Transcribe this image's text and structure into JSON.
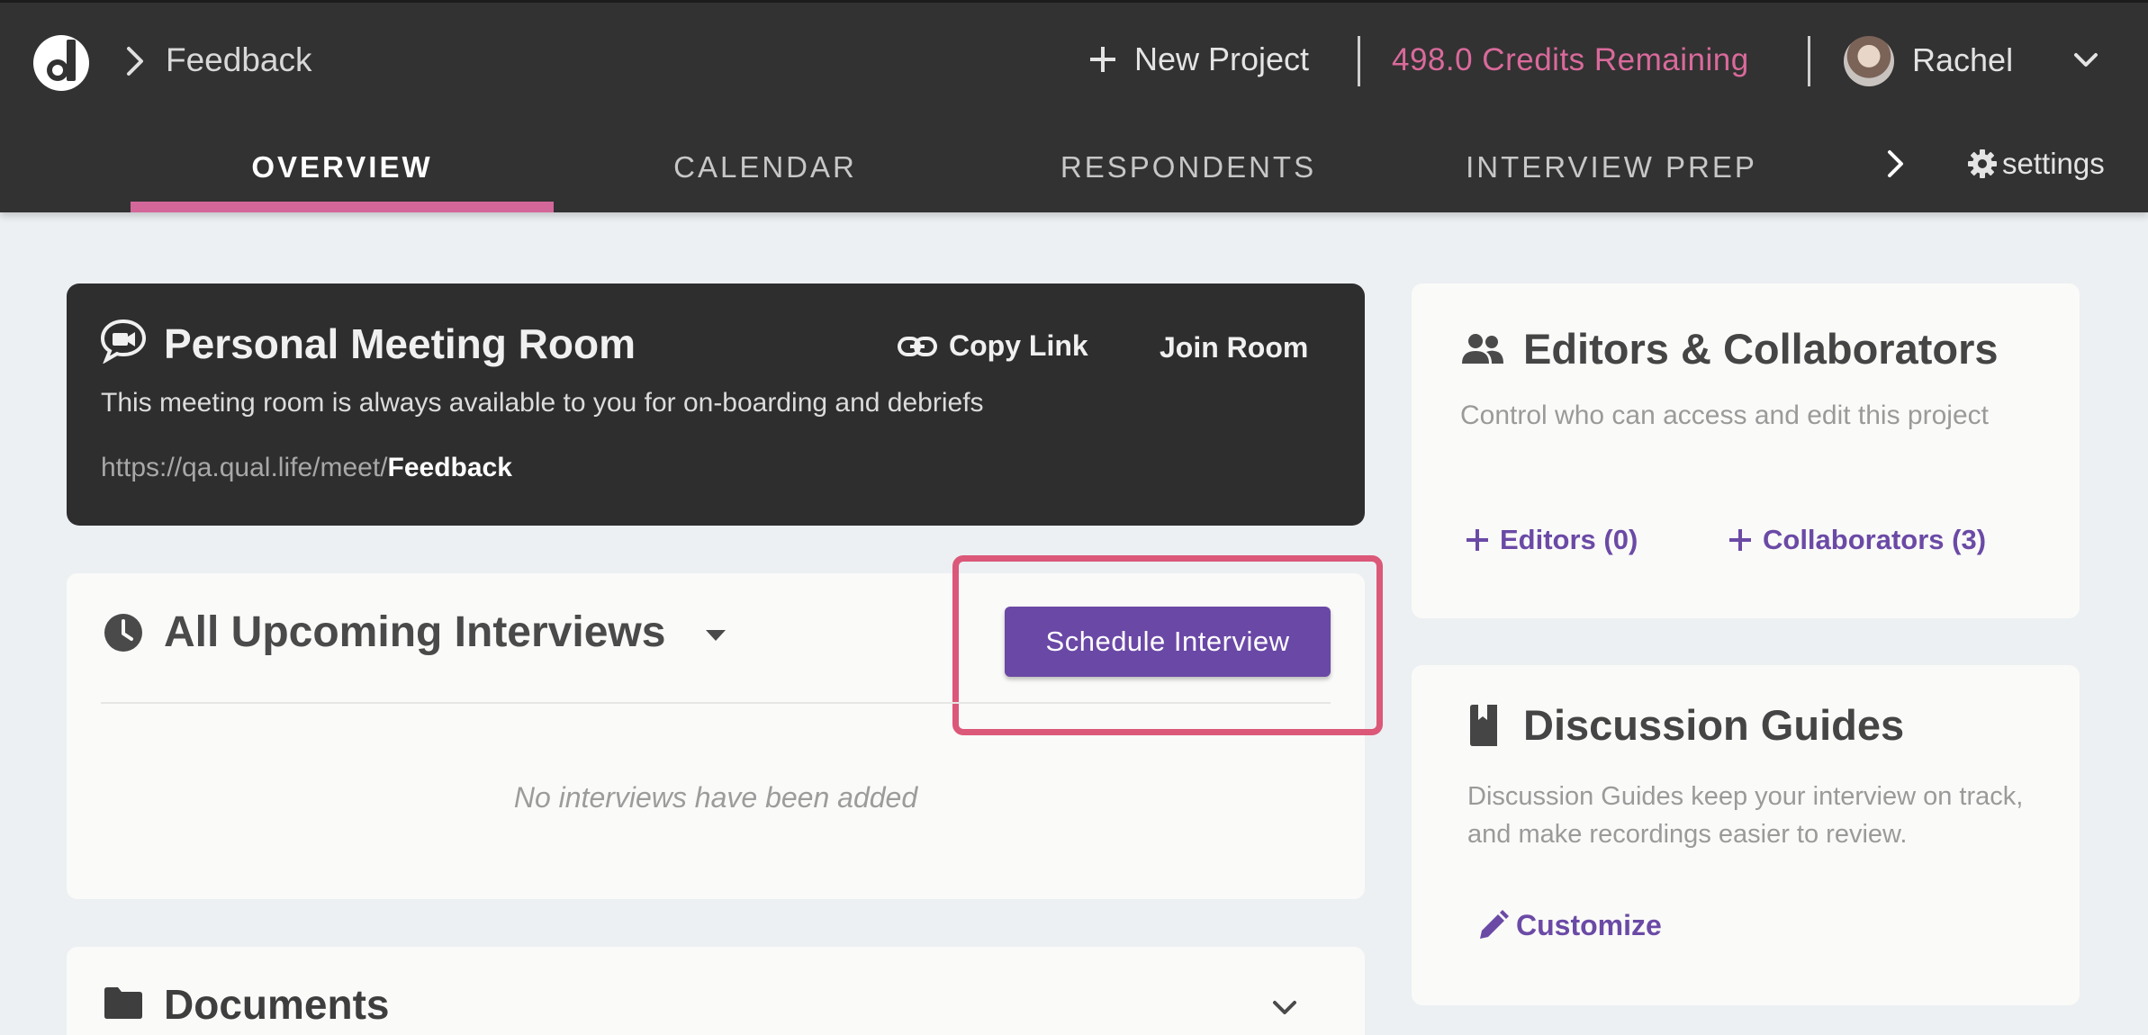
{
  "header": {
    "logo_icon": "logo-d-icon",
    "breadcrumb": "Feedback",
    "new_project_label": "New Project",
    "credits_text": "498.0 Credits Remaining",
    "user_name": "Rachel",
    "settings_label": "settings",
    "tabs": [
      {
        "label": "OVERVIEW",
        "active": true
      },
      {
        "label": "CALENDAR",
        "active": false
      },
      {
        "label": "RESPONDENTS",
        "active": false
      },
      {
        "label": "INTERVIEW PREP",
        "active": false
      }
    ]
  },
  "meeting_room": {
    "title": "Personal Meeting Room",
    "copy_link_label": "Copy Link",
    "join_room_label": "Join Room",
    "description": "This meeting room is always available to you for on-boarding and debriefs",
    "url_base": "https://qa.qual.life/meet/",
    "url_slug": "Feedback"
  },
  "upcoming": {
    "title": "All Upcoming Interviews",
    "schedule_button": "Schedule Interview",
    "empty_message": "No interviews have been added"
  },
  "documents": {
    "title": "Documents"
  },
  "editors": {
    "title": "Editors & Collaborators",
    "description": "Control who can access and edit this project",
    "editors_link": "Editors (0)",
    "collaborators_link": "Collaborators (3)"
  },
  "guides": {
    "title": "Discussion Guides",
    "description": "Discussion Guides keep your interview on track, and make recordings easier to review.",
    "customize_label": "Customize"
  },
  "colors": {
    "topbar": "#323232",
    "accent_pink": "#d3679a",
    "credits": "#d96a9b",
    "primary_purple": "#6a48a6",
    "highlight": "#dc5878",
    "page_bg": "#ecf0f3"
  }
}
